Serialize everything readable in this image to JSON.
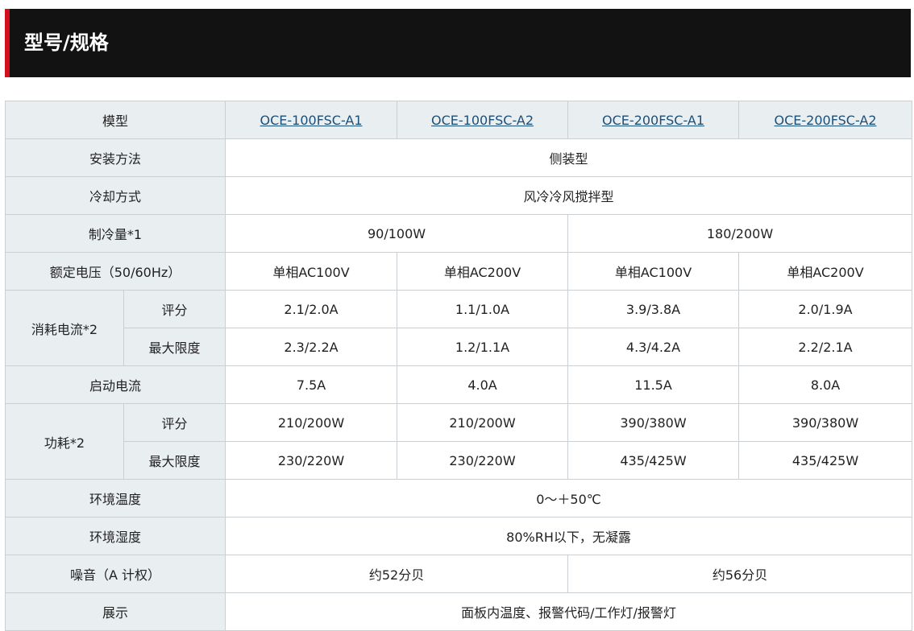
{
  "header": {
    "title": "型号/规格"
  },
  "table": {
    "model_label": "模型",
    "models": [
      "OCE-100FSC-A1",
      "OCE-100FSC-A2",
      "OCE-200FSC-A1",
      "OCE-200FSC-A2"
    ],
    "rows": {
      "install": {
        "label": "安装方法",
        "value": "侧装型"
      },
      "cooling_method": {
        "label": "冷却方式",
        "value": "风冷冷风搅拌型"
      },
      "capacity": {
        "label": "制冷量*1",
        "values": [
          "90/100W",
          "180/200W"
        ]
      },
      "voltage": {
        "label": "额定电压（50/60Hz）",
        "values": [
          "单相AC100V",
          "单相AC200V",
          "单相AC100V",
          "单相AC200V"
        ]
      },
      "current": {
        "label": "消耗电流*2",
        "rated_label": "评分",
        "rated": [
          "2.1/2.0A",
          "1.1/1.0A",
          "3.9/3.8A",
          "2.0/1.9A"
        ],
        "max_label": "最大限度",
        "max": [
          "2.3/2.2A",
          "1.2/1.1A",
          "4.3/4.2A",
          "2.2/2.1A"
        ]
      },
      "start_current": {
        "label": "启动电流",
        "values": [
          "7.5A",
          "4.0A",
          "11.5A",
          "8.0A"
        ]
      },
      "power": {
        "label": "功耗*2",
        "rated_label": "评分",
        "rated": [
          "210/200W",
          "210/200W",
          "390/380W",
          "390/380W"
        ],
        "max_label": "最大限度",
        "max": [
          "230/220W",
          "230/220W",
          "435/425W",
          "435/425W"
        ]
      },
      "ambient_temp": {
        "label": "环境温度",
        "value": "0～＋50℃"
      },
      "ambient_humidity": {
        "label": "环境湿度",
        "value": "80%RH以下，无凝露"
      },
      "noise": {
        "label": "噪音（A 计权）",
        "values": [
          "约52分贝",
          "约56分贝"
        ]
      },
      "display": {
        "label": "展示",
        "value": "面板内温度、报警代码/工作灯/报警灯"
      }
    }
  }
}
